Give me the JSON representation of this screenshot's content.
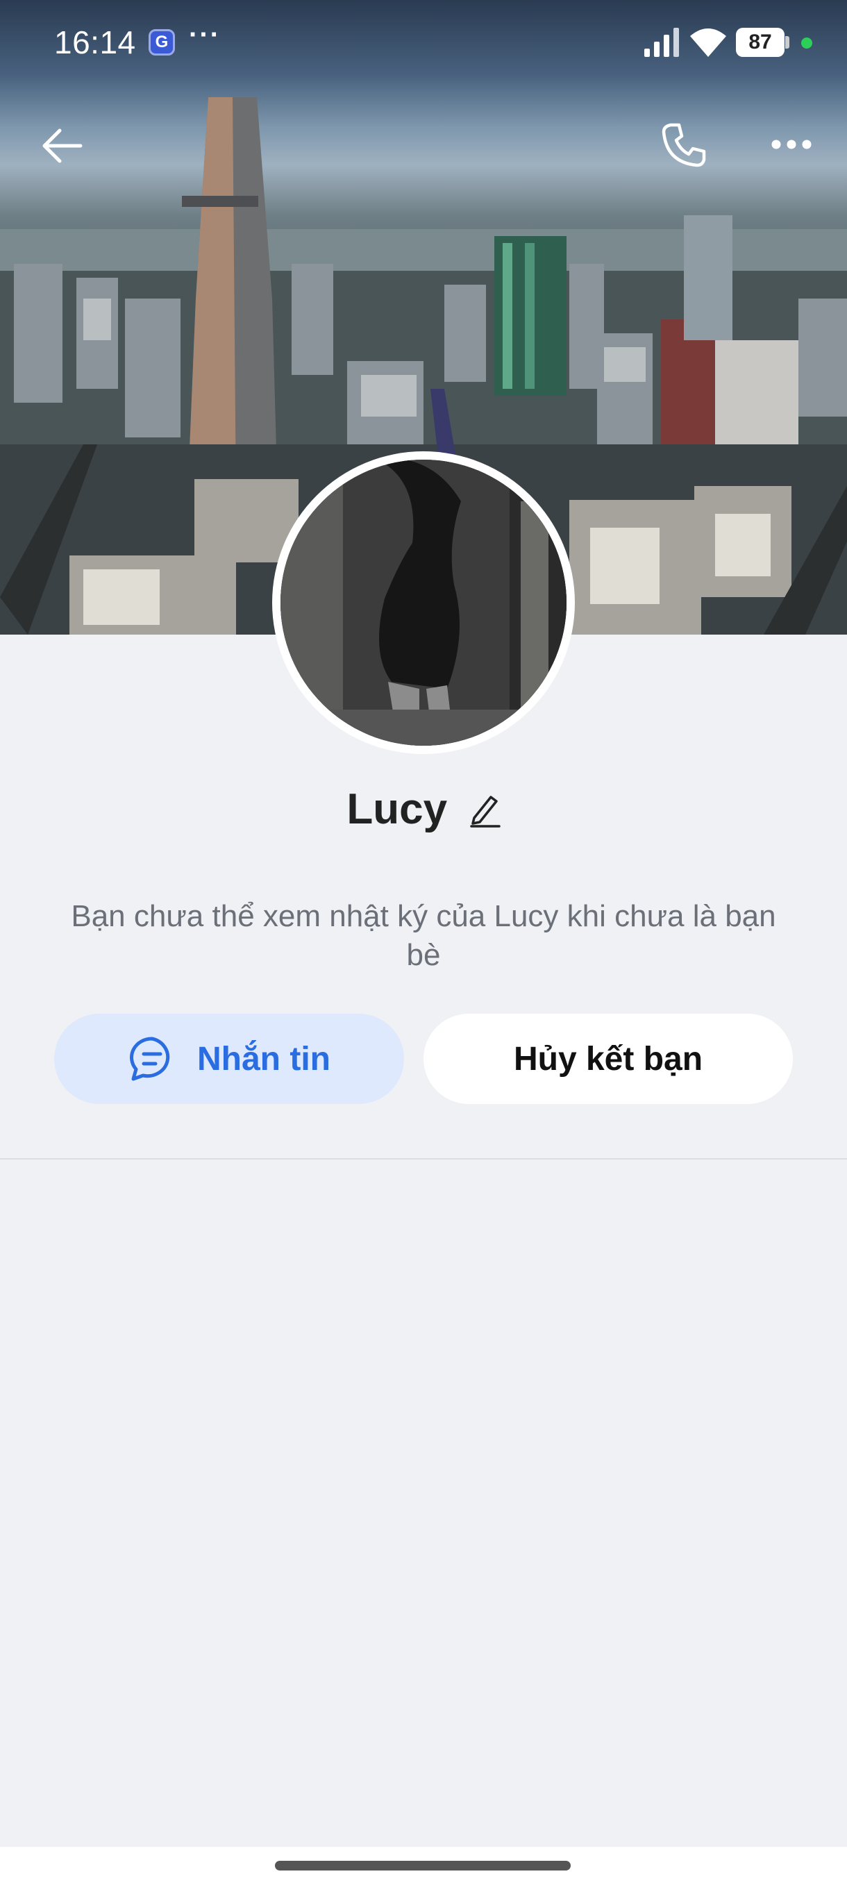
{
  "status_bar": {
    "time": "16:14",
    "app_icon": "G",
    "more": "···",
    "battery": "87"
  },
  "profile": {
    "name": "Lucy",
    "notice": "Bạn chưa thể xem nhật ký của Lucy khi chưa là bạn bè"
  },
  "actions": {
    "message_label": "Nhắn tin",
    "unfriend_label": "Hủy kết bạn"
  },
  "icons": {
    "back": "arrow-left-icon",
    "call": "phone-icon",
    "menu": "more-horizontal-icon",
    "edit": "pencil-icon",
    "chat": "chat-bubble-icon"
  },
  "colors": {
    "accent": "#2a6de0",
    "message_button_bg": "#dfe9fd",
    "page_bg": "#f0f1f5"
  }
}
